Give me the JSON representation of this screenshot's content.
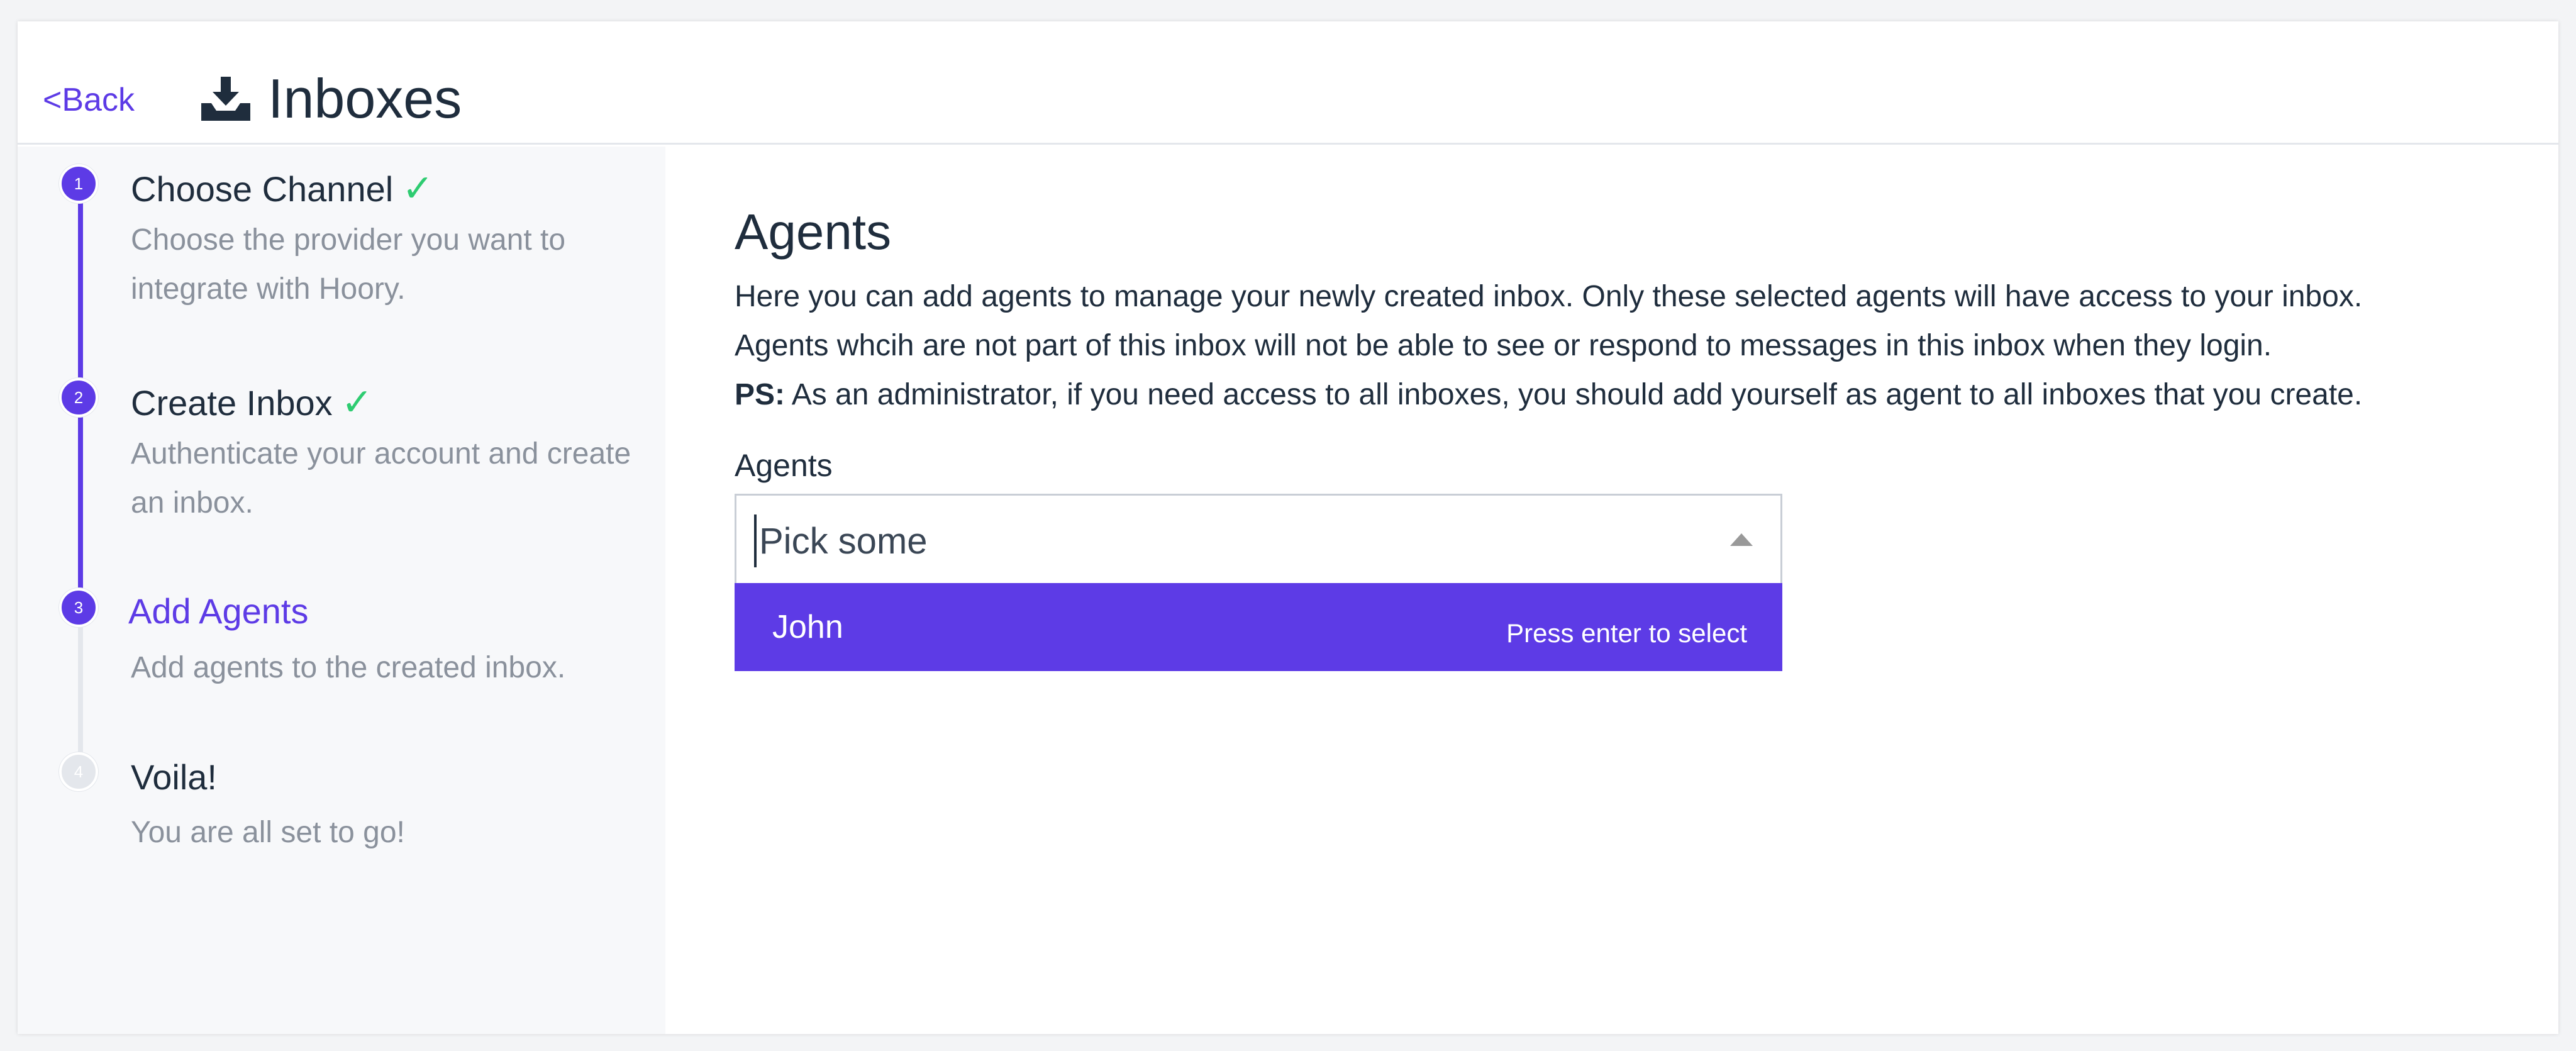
{
  "header": {
    "back_label": "<Back",
    "title": "Inboxes",
    "title_icon": "inbox-download-icon"
  },
  "steps": [
    {
      "number": "1",
      "title": "Choose Channel",
      "description": "Choose the provider you want to integrate with Hoory.",
      "status": "completed"
    },
    {
      "number": "2",
      "title": "Create Inbox",
      "description": "Authenticate your account and create an inbox.",
      "status": "completed"
    },
    {
      "number": "3",
      "title": "Add Agents",
      "description": "Add agents to the created inbox.",
      "status": "active"
    },
    {
      "number": "4",
      "title": "Voila!",
      "description": "You are all set to go!",
      "status": "pending"
    }
  ],
  "main": {
    "title": "Agents",
    "description_line1": "Here you can add agents to manage your newly created inbox. Only these selected agents will have access to your inbox.",
    "description_line2": "Agents whcih are not part of this inbox will not be able to see or respond to messages in this inbox when they login.",
    "ps_label": "PS:",
    "ps_text": " As an administrator, if you need access to all inboxes, you should add yourself as agent to all inboxes that you create.",
    "field_label": "Agents",
    "select_placeholder": "Pick some",
    "options": [
      {
        "label": "John",
        "hint": "Press enter to select"
      }
    ]
  },
  "colors": {
    "accent": "#5d3be6",
    "check": "#2ecc71",
    "muted_text": "#8a919c"
  }
}
